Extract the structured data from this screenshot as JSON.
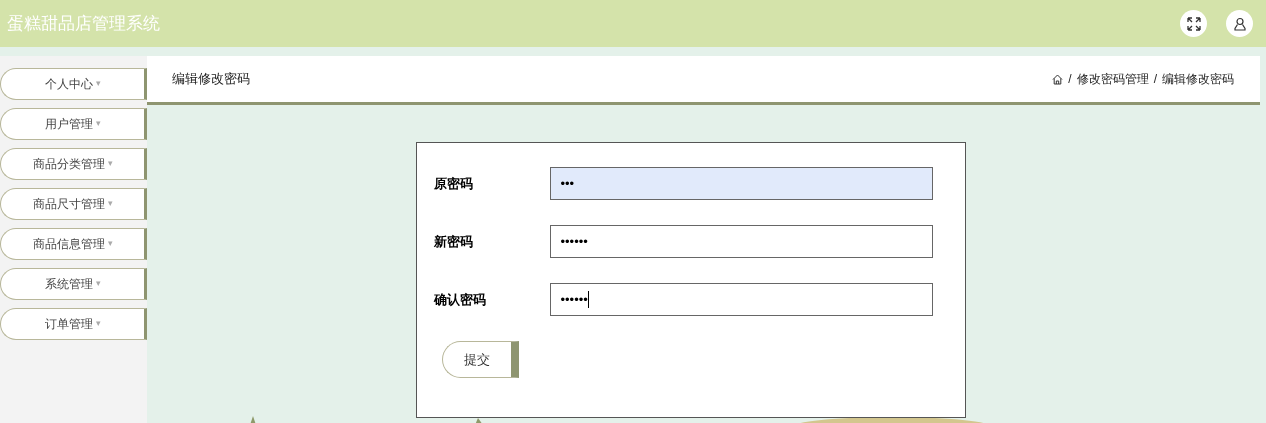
{
  "header": {
    "title": "蛋糕甜品店管理系统"
  },
  "sidebar": {
    "items": [
      {
        "label": "个人中心",
        "caret": "▾"
      },
      {
        "label": "用户管理",
        "caret": "▾"
      },
      {
        "label": "商品分类管理",
        "caret": "▾"
      },
      {
        "label": "商品尺寸管理",
        "caret": "▾"
      },
      {
        "label": "商品信息管理",
        "caret": "▾"
      },
      {
        "label": "系统管理",
        "caret": "▾"
      },
      {
        "label": "订单管理",
        "caret": "▾"
      }
    ]
  },
  "page_header": {
    "title": "编辑修改密码",
    "breadcrumb": [
      "修改密码管理",
      "编辑修改密码"
    ],
    "separator": "/"
  },
  "form": {
    "fields": [
      {
        "label": "原密码",
        "value": "•••",
        "autofilled": true,
        "focused": false
      },
      {
        "label": "新密码",
        "value": "••••••",
        "autofilled": false,
        "focused": false
      },
      {
        "label": "确认密码",
        "value": "••••••",
        "autofilled": false,
        "focused": true
      }
    ],
    "submit": "提交"
  }
}
